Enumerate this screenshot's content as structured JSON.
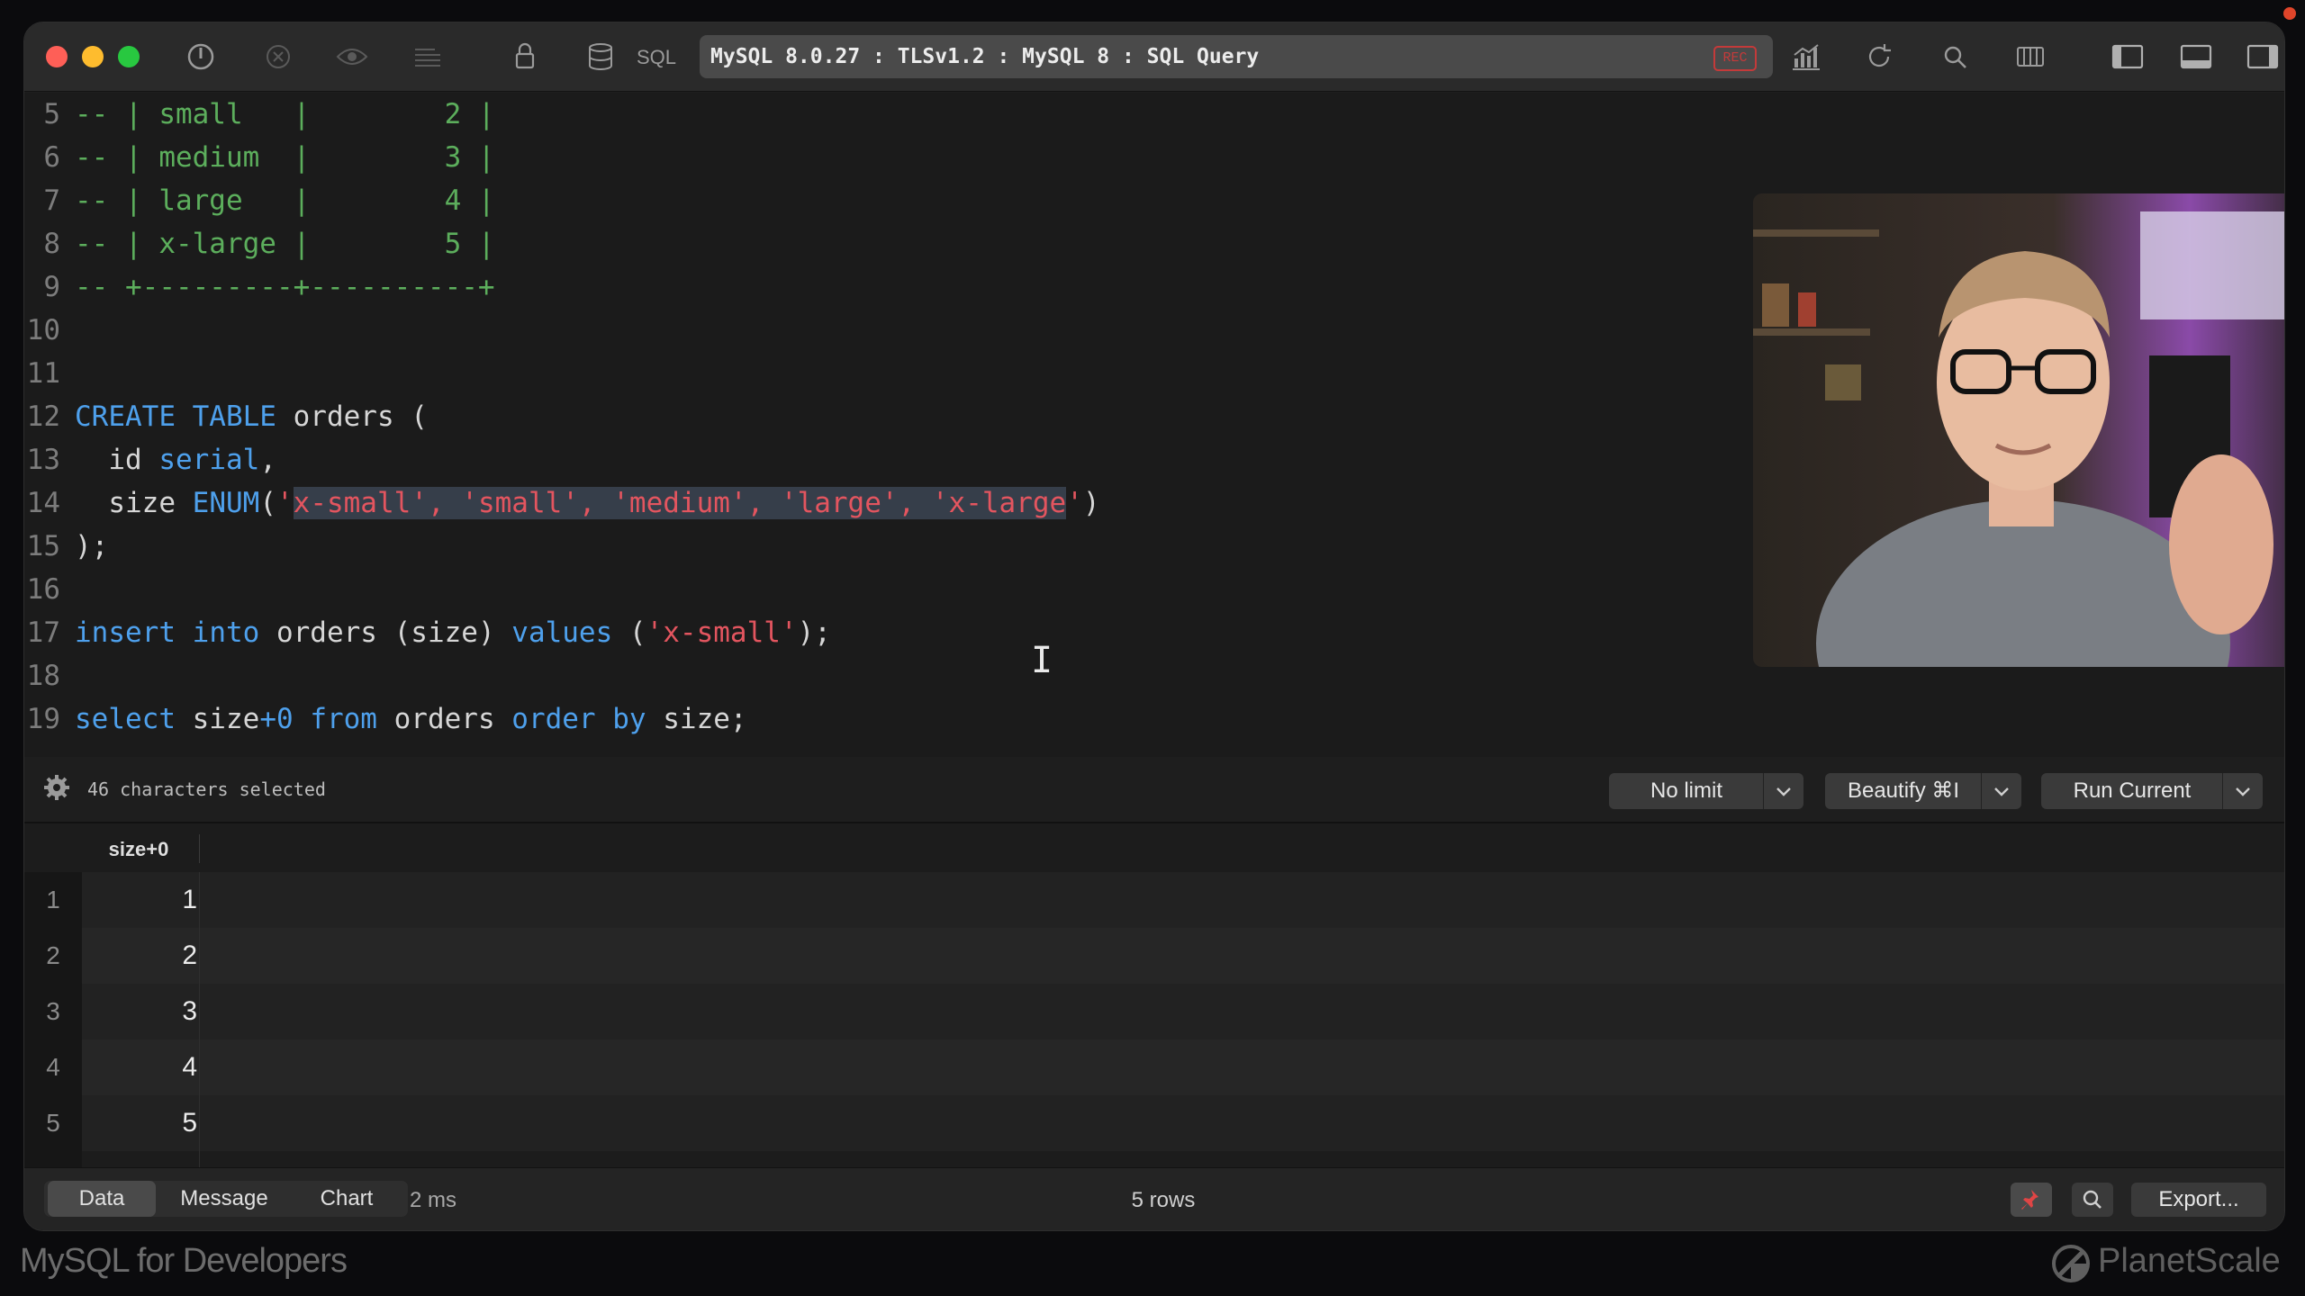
{
  "toolbar": {
    "sql_label": "SQL",
    "connection": "MySQL 8.0.27 : TLSv1.2 : MySQL 8 : SQL Query",
    "rec_label": "REC",
    "icons": [
      "power-icon",
      "stop-icon",
      "eye-icon",
      "list-icon",
      "lock-icon",
      "database-icon",
      "chart-icon",
      "refresh-icon",
      "search-icon",
      "columns-icon",
      "sidebar-left-icon",
      "panel-bottom-icon",
      "sidebar-right-icon"
    ]
  },
  "editor": {
    "lines": [
      {
        "n": "5",
        "text": "-- | small   |        2 |"
      },
      {
        "n": "6",
        "text": "-- | medium  |        3 |"
      },
      {
        "n": "7",
        "text": "-- | large   |        4 |"
      },
      {
        "n": "8",
        "text": "-- | x-large |        5 |"
      },
      {
        "n": "9",
        "text": "-- +---------+----------+"
      },
      {
        "n": "10"
      },
      {
        "n": "11"
      },
      {
        "n": "12",
        "kw1": "CREATE TABLE",
        "rest": " orders ("
      },
      {
        "n": "13",
        "pre": "  id ",
        "kw": "serial",
        "post": ","
      },
      {
        "n": "14",
        "pre": "  size ",
        "kw": "ENUM",
        "open": "(",
        "q1": "'",
        "s_sel": "x-small', 'small', 'medium', 'large', 'x-large",
        "q2": "'",
        "close": ")"
      },
      {
        "n": "15",
        "text": ");"
      },
      {
        "n": "16"
      },
      {
        "n": "17",
        "kw1": "insert",
        "sp1": " ",
        "kw2": "into",
        "mid": " orders (size) ",
        "kw3": "values",
        "str_open": " (",
        "str": "'x-small'",
        "end": ");"
      },
      {
        "n": "18"
      },
      {
        "n": "19",
        "kw1": "select",
        "mid1": " size",
        "num": "+0",
        "sp": " ",
        "kw2": "from",
        "mid2": " orders ",
        "kw3": "order by",
        "end": " size;"
      }
    ]
  },
  "status": {
    "selection": "46 characters selected",
    "limit_label": "No limit",
    "beautify_label": "Beautify ⌘I",
    "run_label": "Run Current"
  },
  "results": {
    "column": "size+0",
    "rows": [
      {
        "n": "1",
        "v": "1"
      },
      {
        "n": "2",
        "v": "2"
      },
      {
        "n": "3",
        "v": "3"
      },
      {
        "n": "4",
        "v": "4"
      },
      {
        "n": "5",
        "v": "5"
      }
    ]
  },
  "bottombar": {
    "tabs": [
      "Data",
      "Message",
      "Chart"
    ],
    "active_tab": "Data",
    "timing": "2 ms",
    "row_count": "5 rows",
    "export_label": "Export..."
  },
  "watermark": {
    "left": "MySQL for Developers",
    "right": "PlanetScale"
  }
}
